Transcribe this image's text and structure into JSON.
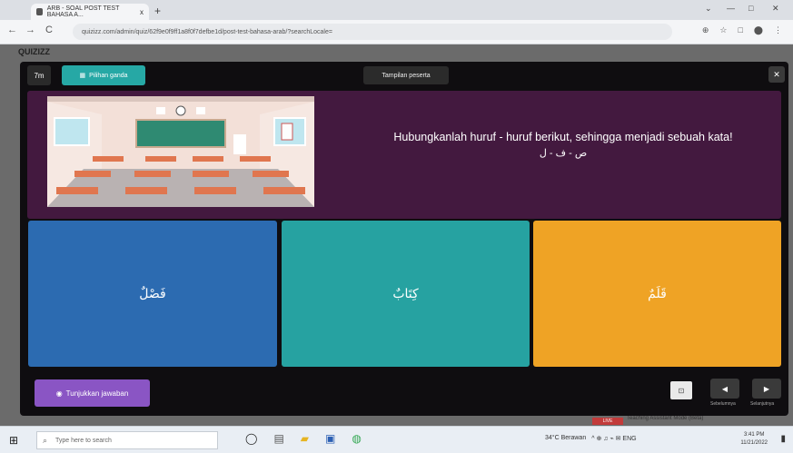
{
  "browser": {
    "tab_title": "ARB - SOAL POST TEST BAHASA A...",
    "tab_close": "x",
    "new_tab": "+",
    "window_controls": [
      "⌄",
      "—",
      "□",
      "✕"
    ],
    "nav": [
      "←",
      "→",
      "C"
    ],
    "url": "quizizz.com/admin/quiz/62f9e0f9ff1a8f0f7defbe1d/post-test-bahasa-arab/?searchLocale=",
    "right_icons": [
      "⊕",
      "☆",
      "□",
      "⬤",
      "⋮"
    ]
  },
  "background": {
    "logo": "QUIZIZZ",
    "behind_text": "Teaching Assistant Mode (Beta)",
    "red_tag": "LIVE"
  },
  "modal": {
    "timer": "7m",
    "pilih_label": "Pilihan ganda",
    "tampilan_label": "Tampilan peserta",
    "close": "✕",
    "question": "Hubungkanlah huruf - huruf berikut, sehingga menjadi sebuah kata!",
    "question_arabic": "ص - ف - ل",
    "options": [
      "فَصْلٌ",
      "كِتَابٌ",
      "قَلَمٌ"
    ],
    "show_answer": "Tunjukkan jawaban",
    "nav_prev_label": "Sebelumnya",
    "nav_next_label": "Selanjutnya",
    "nav_prev": "◀",
    "nav_next": "▶",
    "box_icon": "⊡"
  },
  "taskbar": {
    "start": "⊞",
    "search_placeholder": "Type here to search",
    "weather": "34°C Berawan",
    "tray_icons": "^ ⊕ ♫ ⌁ ✉ ENG",
    "time": "3:41 PM",
    "date": "11/21/2022",
    "notif": "▮"
  },
  "colors": {
    "modal_bg": "#0f0d10",
    "question_bg": "#43193f",
    "option_blue": "#2c6bb1",
    "option_teal": "#26a2a1",
    "option_orange": "#efa325",
    "accent_purple": "#8a55c4"
  }
}
